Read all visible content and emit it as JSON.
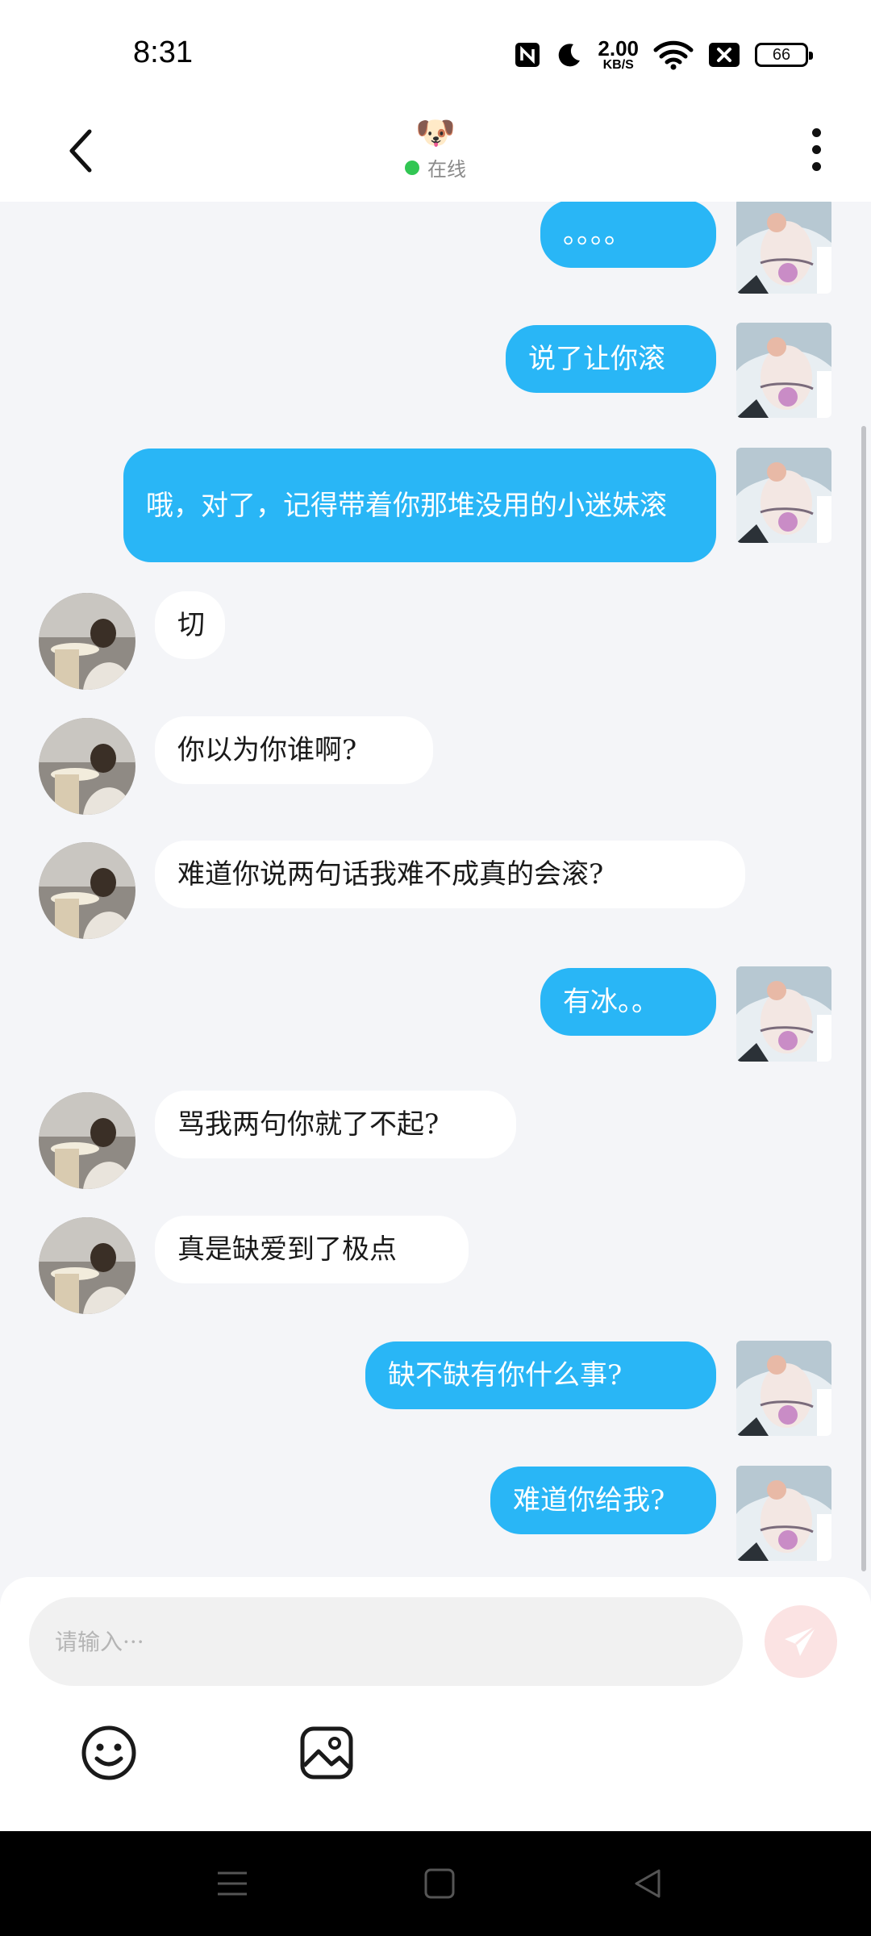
{
  "status_bar": {
    "time": "8:31",
    "net_speed_value": "2.00",
    "net_speed_unit": "KB/S",
    "battery": "66"
  },
  "header": {
    "avatar_emoji": "🐶",
    "status_text": "在线"
  },
  "messages": [
    {
      "dir": "out",
      "text": "。。。。"
    },
    {
      "dir": "out",
      "text": "说了让你滚"
    },
    {
      "dir": "out",
      "text": "哦，对了，记得带着你那堆没用的小迷妹滚"
    },
    {
      "dir": "in",
      "text": "切"
    },
    {
      "dir": "in",
      "text": "你以为你谁啊?"
    },
    {
      "dir": "in",
      "text": "难道你说两句话我难不成真的会滚?"
    },
    {
      "dir": "out",
      "text": "有冰。。"
    },
    {
      "dir": "in",
      "text": "骂我两句你就了不起?"
    },
    {
      "dir": "in",
      "text": "真是缺爱到了极点"
    },
    {
      "dir": "out",
      "text": "缺不缺有你什么事?"
    },
    {
      "dir": "out",
      "text": "难道你给我?"
    }
  ],
  "input": {
    "placeholder": "请输入···",
    "value": ""
  },
  "colors": {
    "outgoing_bubble": "#29b6f6",
    "incoming_bubble": "#ffffff",
    "background": "#f4f5f8",
    "online_dot": "#31c653",
    "send_button": "#fbe3e3"
  },
  "icons": {
    "back": "chevron-left-icon",
    "more": "more-vertical-icon",
    "send": "paper-plane-icon",
    "emoji": "smiley-icon",
    "image": "image-icon"
  }
}
